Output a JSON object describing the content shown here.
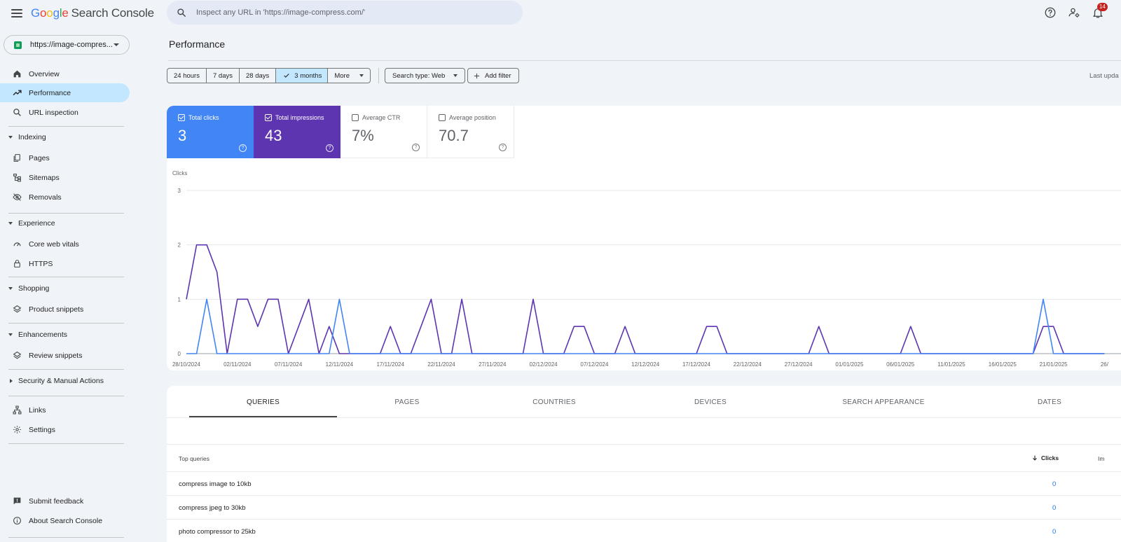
{
  "app": {
    "logo_letters": [
      "G",
      "o",
      "o",
      "g",
      "l",
      "e"
    ],
    "product": "Search Console",
    "search_placeholder": "Inspect any URL in 'https://image-compress.com/'",
    "notification_count": "14"
  },
  "sidebar": {
    "property": "https://image-compres...",
    "nav": {
      "overview": "Overview",
      "performance": "Performance",
      "url_inspection": "URL inspection",
      "indexing": "Indexing",
      "pages": "Pages",
      "sitemaps": "Sitemaps",
      "removals": "Removals",
      "experience": "Experience",
      "core_web_vitals": "Core web vitals",
      "https": "HTTPS",
      "shopping": "Shopping",
      "product_snippets": "Product snippets",
      "enhancements": "Enhancements",
      "review_snippets": "Review snippets",
      "security": "Security & Manual Actions",
      "links": "Links",
      "settings": "Settings",
      "submit_feedback": "Submit feedback",
      "about": "About Search Console"
    }
  },
  "main": {
    "title": "Performance",
    "date_ranges": [
      "24 hours",
      "7 days",
      "28 days",
      "3 months"
    ],
    "more_label": "More",
    "search_type": "Search type: Web",
    "add_filter": "Add filter",
    "last_updated": "Last upda",
    "metrics": {
      "clicks": {
        "label": "Total clicks",
        "value": "3",
        "checked": true,
        "color": "#4285f4"
      },
      "impressions": {
        "label": "Total impressions",
        "value": "43",
        "checked": true,
        "color": "#5e35b1"
      },
      "ctr": {
        "label": "Average CTR",
        "value": "7%",
        "checked": false
      },
      "position": {
        "label": "Average position",
        "value": "70.7",
        "checked": false
      }
    },
    "tabs": [
      "QUERIES",
      "PAGES",
      "COUNTRIES",
      "DEVICES",
      "SEARCH APPEARANCE",
      "DATES"
    ],
    "table": {
      "col_query": "Top queries",
      "col_clicks": "Clicks",
      "col_impressions": "Im",
      "rows": [
        {
          "query": "compress image to 10kb",
          "clicks": "0"
        },
        {
          "query": "compress jpeg to 30kb",
          "clicks": "0"
        },
        {
          "query": "photo compressor to 25kb",
          "clicks": "0"
        }
      ]
    }
  },
  "chart_data": {
    "type": "line",
    "ylabel": "Clicks",
    "ylim": [
      0,
      3
    ],
    "yticks": [
      0,
      1,
      2,
      3
    ],
    "x_tick_labels": [
      "28/10/2024",
      "02/11/2024",
      "07/11/2024",
      "12/11/2024",
      "17/11/2024",
      "22/11/2024",
      "27/11/2024",
      "02/12/2024",
      "07/12/2024",
      "12/12/2024",
      "17/12/2024",
      "22/12/2024",
      "27/12/2024",
      "01/01/2025",
      "06/01/2025",
      "11/01/2025",
      "16/01/2025",
      "21/01/2025",
      "26/"
    ],
    "x_start": "2024-10-28",
    "series": [
      {
        "key": "impressions",
        "color": "#5e35b1",
        "points": [
          [
            "2024-10-28",
            1
          ],
          [
            "2024-10-29",
            2
          ],
          [
            "2024-10-30",
            2
          ],
          [
            "2024-10-31",
            1.5
          ],
          [
            "2024-11-01",
            0
          ],
          [
            "2024-11-02",
            1
          ],
          [
            "2024-11-03",
            1
          ],
          [
            "2024-11-04",
            0.5
          ],
          [
            "2024-11-05",
            1
          ],
          [
            "2024-11-06",
            1
          ],
          [
            "2024-11-07",
            0
          ],
          [
            "2024-11-08",
            0.5
          ],
          [
            "2024-11-09",
            1
          ],
          [
            "2024-11-10",
            0
          ],
          [
            "2024-11-11",
            0.5
          ],
          [
            "2024-11-12",
            0
          ],
          [
            "2024-11-16",
            0
          ],
          [
            "2024-11-17",
            0.5
          ],
          [
            "2024-11-18",
            0
          ],
          [
            "2024-11-19",
            0
          ],
          [
            "2024-11-20",
            0.5
          ],
          [
            "2024-11-21",
            1
          ],
          [
            "2024-11-22",
            0
          ],
          [
            "2024-11-23",
            0
          ],
          [
            "2024-11-24",
            1
          ],
          [
            "2024-11-25",
            0
          ],
          [
            "2024-11-30",
            0
          ],
          [
            "2024-12-01",
            1
          ],
          [
            "2024-12-02",
            0
          ],
          [
            "2024-12-04",
            0
          ],
          [
            "2024-12-05",
            0.5
          ],
          [
            "2024-12-06",
            0.5
          ],
          [
            "2024-12-07",
            0
          ],
          [
            "2024-12-09",
            0
          ],
          [
            "2024-12-10",
            0.5
          ],
          [
            "2024-12-11",
            0
          ],
          [
            "2024-12-17",
            0
          ],
          [
            "2024-12-18",
            0.5
          ],
          [
            "2024-12-19",
            0.5
          ],
          [
            "2024-12-20",
            0
          ],
          [
            "2024-12-28",
            0
          ],
          [
            "2024-12-29",
            0.5
          ],
          [
            "2024-12-30",
            0
          ],
          [
            "2025-01-06",
            0
          ],
          [
            "2025-01-07",
            0.5
          ],
          [
            "2025-01-08",
            0
          ],
          [
            "2025-01-19",
            0
          ],
          [
            "2025-01-20",
            0.5
          ],
          [
            "2025-01-21",
            0.5
          ],
          [
            "2025-01-22",
            0
          ],
          [
            "2025-01-26",
            0
          ]
        ]
      },
      {
        "key": "clicks",
        "color": "#4285f4",
        "points": [
          [
            "2024-10-28",
            0
          ],
          [
            "2024-10-29",
            0
          ],
          [
            "2024-10-30",
            1
          ],
          [
            "2024-10-31",
            0
          ],
          [
            "2024-11-11",
            0
          ],
          [
            "2024-11-12",
            1
          ],
          [
            "2024-11-13",
            0
          ],
          [
            "2025-01-19",
            0
          ],
          [
            "2025-01-20",
            1
          ],
          [
            "2025-01-21",
            0
          ],
          [
            "2025-01-26",
            0
          ]
        ]
      }
    ]
  }
}
